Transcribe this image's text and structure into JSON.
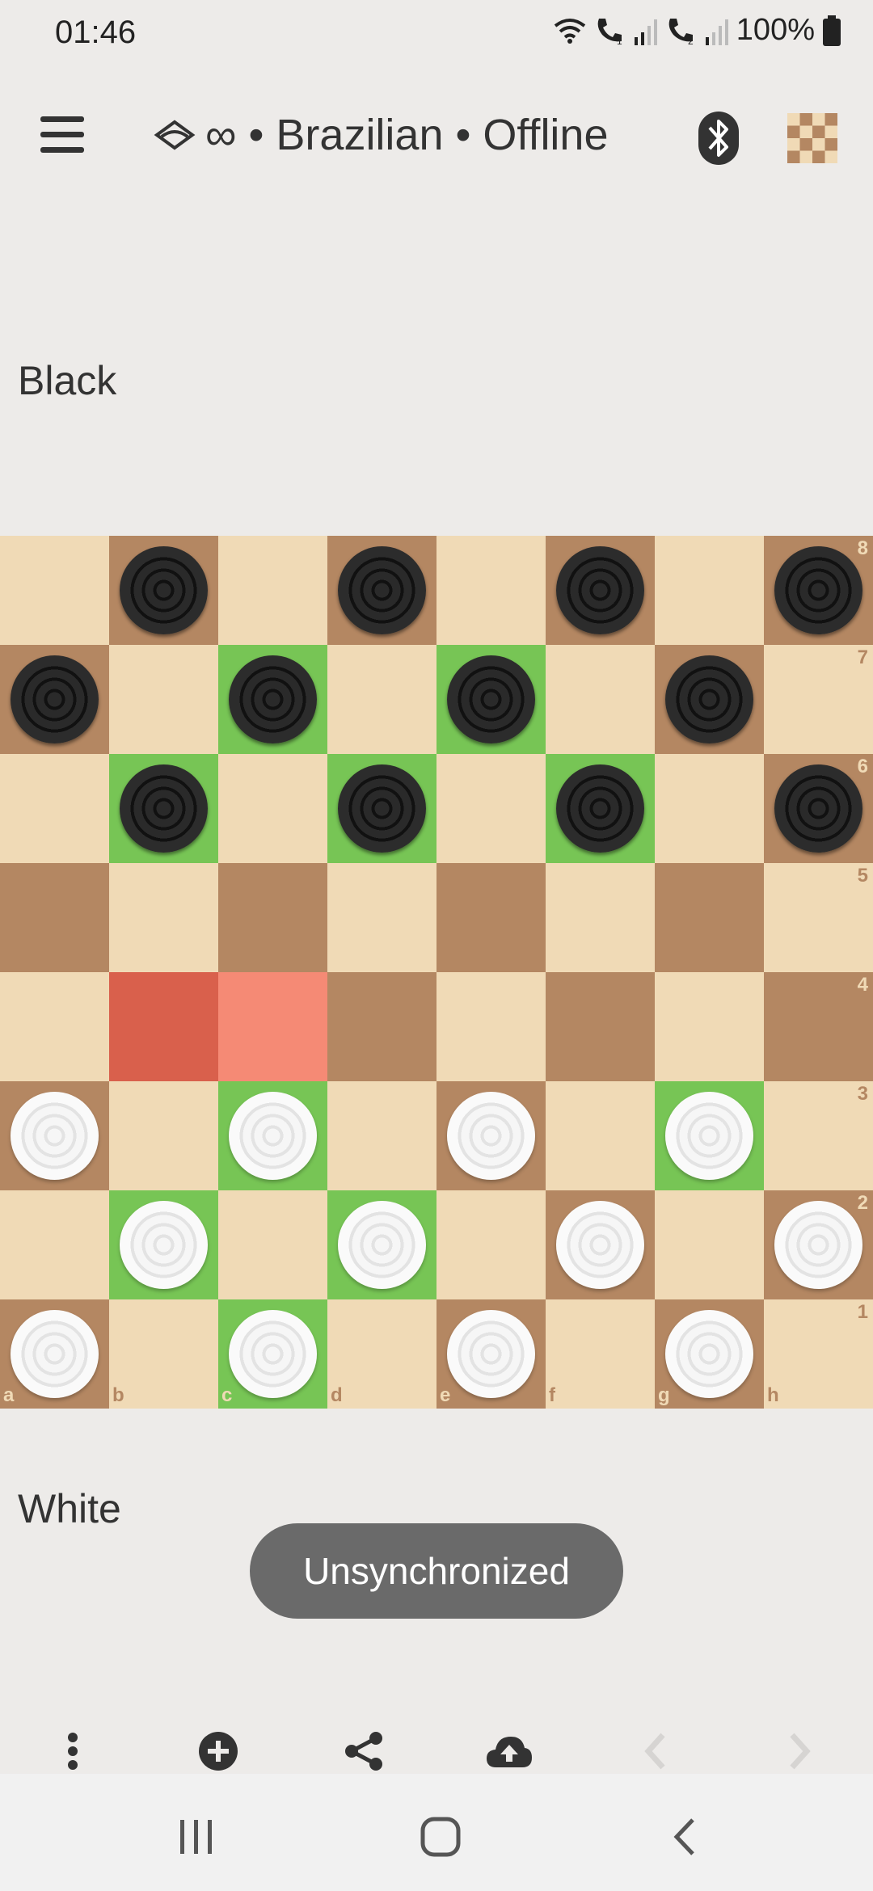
{
  "status_bar": {
    "time": "01:46",
    "battery": "100%",
    "icons": [
      "wifi-icon",
      "call-sim1-icon",
      "signal-icon",
      "call-sim2-icon",
      "signal-icon",
      "battery-icon"
    ]
  },
  "app_bar": {
    "title": "∞ • Brazilian • Offline",
    "icons": [
      "menu-icon",
      "variant-icon",
      "bluetooth-icon",
      "board-theme-icon"
    ]
  },
  "players": {
    "top": "Black",
    "bottom": "White"
  },
  "board": {
    "ranks": [
      "8",
      "7",
      "6",
      "5",
      "4",
      "3",
      "2",
      "1"
    ],
    "files": [
      "a",
      "b",
      "c",
      "d",
      "e",
      "f",
      "g",
      "h"
    ],
    "black_pieces": [
      "b8",
      "d8",
      "f8",
      "h8",
      "a7",
      "c7",
      "e7",
      "g7",
      "b6",
      "d6",
      "f6",
      "h6"
    ],
    "white_pieces": [
      "a3",
      "c3",
      "e3",
      "g3",
      "b2",
      "d2",
      "f2",
      "h2",
      "a1",
      "c1",
      "e1",
      "g1"
    ],
    "highlight_movable": [
      "c7",
      "e7",
      "b6",
      "d6",
      "f6",
      "c3",
      "g3",
      "b2",
      "d2",
      "c1"
    ],
    "last_move_from": "b4",
    "last_move_to": "c4",
    "colors": {
      "light": "#f0dab6",
      "dark": "#b48762",
      "highlight": "#77c555",
      "last_from": "#d9604c",
      "last_to": "#f58a75"
    }
  },
  "toast": {
    "text": "Unsynchronized"
  },
  "toolbar": {
    "buttons": [
      "more-vert-icon",
      "add-circle-icon",
      "share-icon",
      "cloud-upload-icon",
      "chevron-left-icon",
      "chevron-right-icon"
    ]
  },
  "nav_bar": {
    "buttons": [
      "recent-apps-icon",
      "home-icon",
      "back-icon"
    ]
  }
}
